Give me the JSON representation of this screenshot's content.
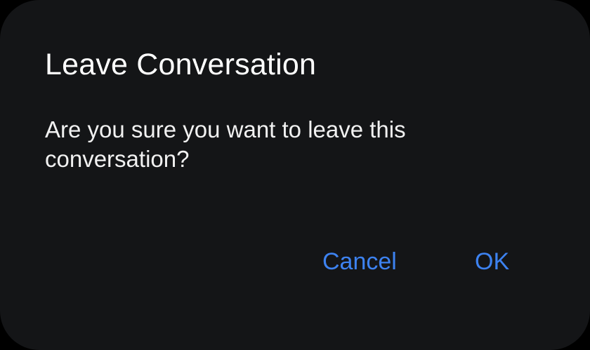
{
  "dialog": {
    "title": "Leave Conversation",
    "message": "Are you sure you want to leave this conversation?",
    "cancel_label": "Cancel",
    "ok_label": "OK"
  },
  "colors": {
    "background": "#141517",
    "accent": "#3d82f0",
    "text": "#ffffff"
  }
}
